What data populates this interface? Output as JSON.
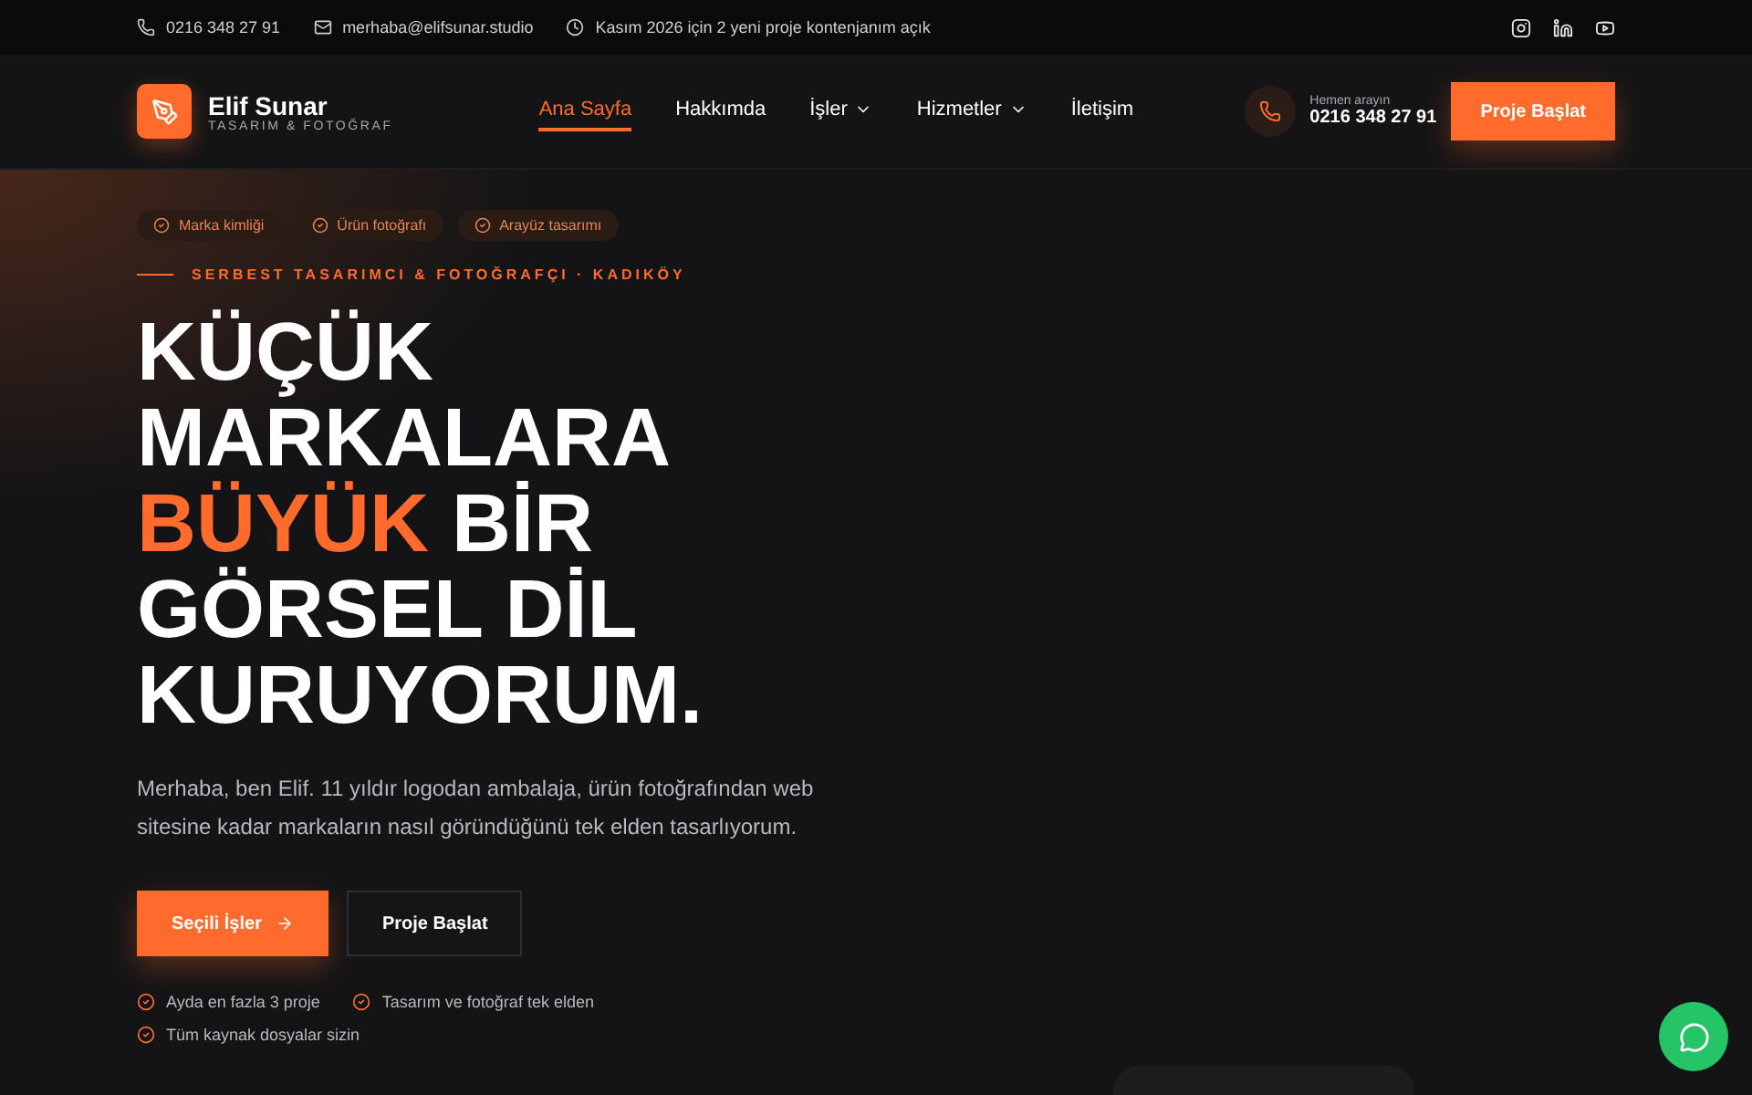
{
  "topbar": {
    "phone": "0216 348 27 91",
    "email": "merhaba@elifsunar.studio",
    "notice": "Kasım 2026 için 2 yeni proje kontenjanım açık"
  },
  "brand": {
    "name": "Elif Sunar",
    "tagline": "TASARIM & FOTOĞRAF"
  },
  "nav": [
    {
      "label": "Ana Sayfa",
      "selected": true,
      "has_menu": false
    },
    {
      "label": "Hakkımda",
      "selected": false,
      "has_menu": false
    },
    {
      "label": "İşler",
      "selected": false,
      "has_menu": true
    },
    {
      "label": "Hizmetler",
      "selected": false,
      "has_menu": true
    },
    {
      "label": "İletişim",
      "selected": false,
      "has_menu": false
    }
  ],
  "call": {
    "caption": "Hemen arayın",
    "phone": "0216 348 27 91"
  },
  "header_button": "Proje Başlat",
  "tags": [
    "Marka kimliği",
    "Ürün fotoğrafı",
    "Arayüz tasarımı"
  ],
  "eyebrow": "SERBEST TASARIMCI & FOTOĞRAFÇI · KADIKÖY",
  "headline": [
    [
      {
        "text": "KÜÇÜK",
        "accent": false
      }
    ],
    [
      {
        "text": "MARKALARA",
        "accent": false
      }
    ],
    [
      {
        "text": "BÜYÜK",
        "accent": true
      },
      {
        "text": " BİR",
        "accent": false
      }
    ],
    [
      {
        "text": "GÖRSEL DİL",
        "accent": false
      }
    ],
    [
      {
        "text": "KURUYORUM.",
        "accent": false
      }
    ]
  ],
  "intro": "Merhaba, ben Elif. 11 yıldır logodan ambalaja, ürün fotoğrafından web sitesine kadar markaların nasıl göründüğünü tek elden tasarlıyorum.",
  "buttons": [
    {
      "label": "Seçili İşler",
      "kind": "primary"
    },
    {
      "label": "Proje Başlat",
      "kind": "outline"
    }
  ],
  "perks": [
    "Ayda en fazla 3 proje",
    "Tasarım ve fotoğraf tek elden",
    "Tüm kaynak dosyalar sizin"
  ]
}
